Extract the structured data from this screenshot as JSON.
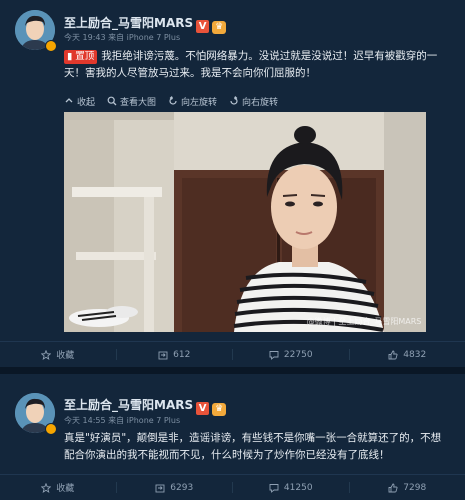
{
  "post1": {
    "username": "至上励合_马雪阳MARS",
    "meta": "今天 19:43 来自 iPhone 7 Plus",
    "pin_label": "置顶",
    "text": "我拒绝诽谤污蔑。不怕网络暴力。没说过就是没说过！迟早有被戳穿的一天！害我的人尽管放马过来。我是不会向你们屈服的！",
    "image_toolbar": {
      "collapse": "收起",
      "view_large": "查看大图",
      "rotate_left": "向左旋转",
      "rotate_right": "向右旋转"
    },
    "watermark": "@微博 | 至上励合_马雪阳MARS",
    "actions": {
      "favorite": "收藏",
      "repost": "612",
      "comment": "22750",
      "like": "4832"
    }
  },
  "post2": {
    "username": "至上励合_马雪阳MARS",
    "meta": "今天 14:55 来自 iPhone 7 Plus",
    "text": "真是\"好演员\"，颠倒是非，造谣诽谤，有些钱不是你嘴一张一合就算还了的，不想配合你演出的我不能视而不见，什么时候为了炒作你已经没有了底线！",
    "actions": {
      "favorite": "收藏",
      "repost": "6293",
      "comment": "41250",
      "like": "7298"
    }
  },
  "colors": {
    "background": "#13263b",
    "text": "#e8edf2",
    "meta": "#7d8fa2",
    "pin": "#e0382c"
  }
}
